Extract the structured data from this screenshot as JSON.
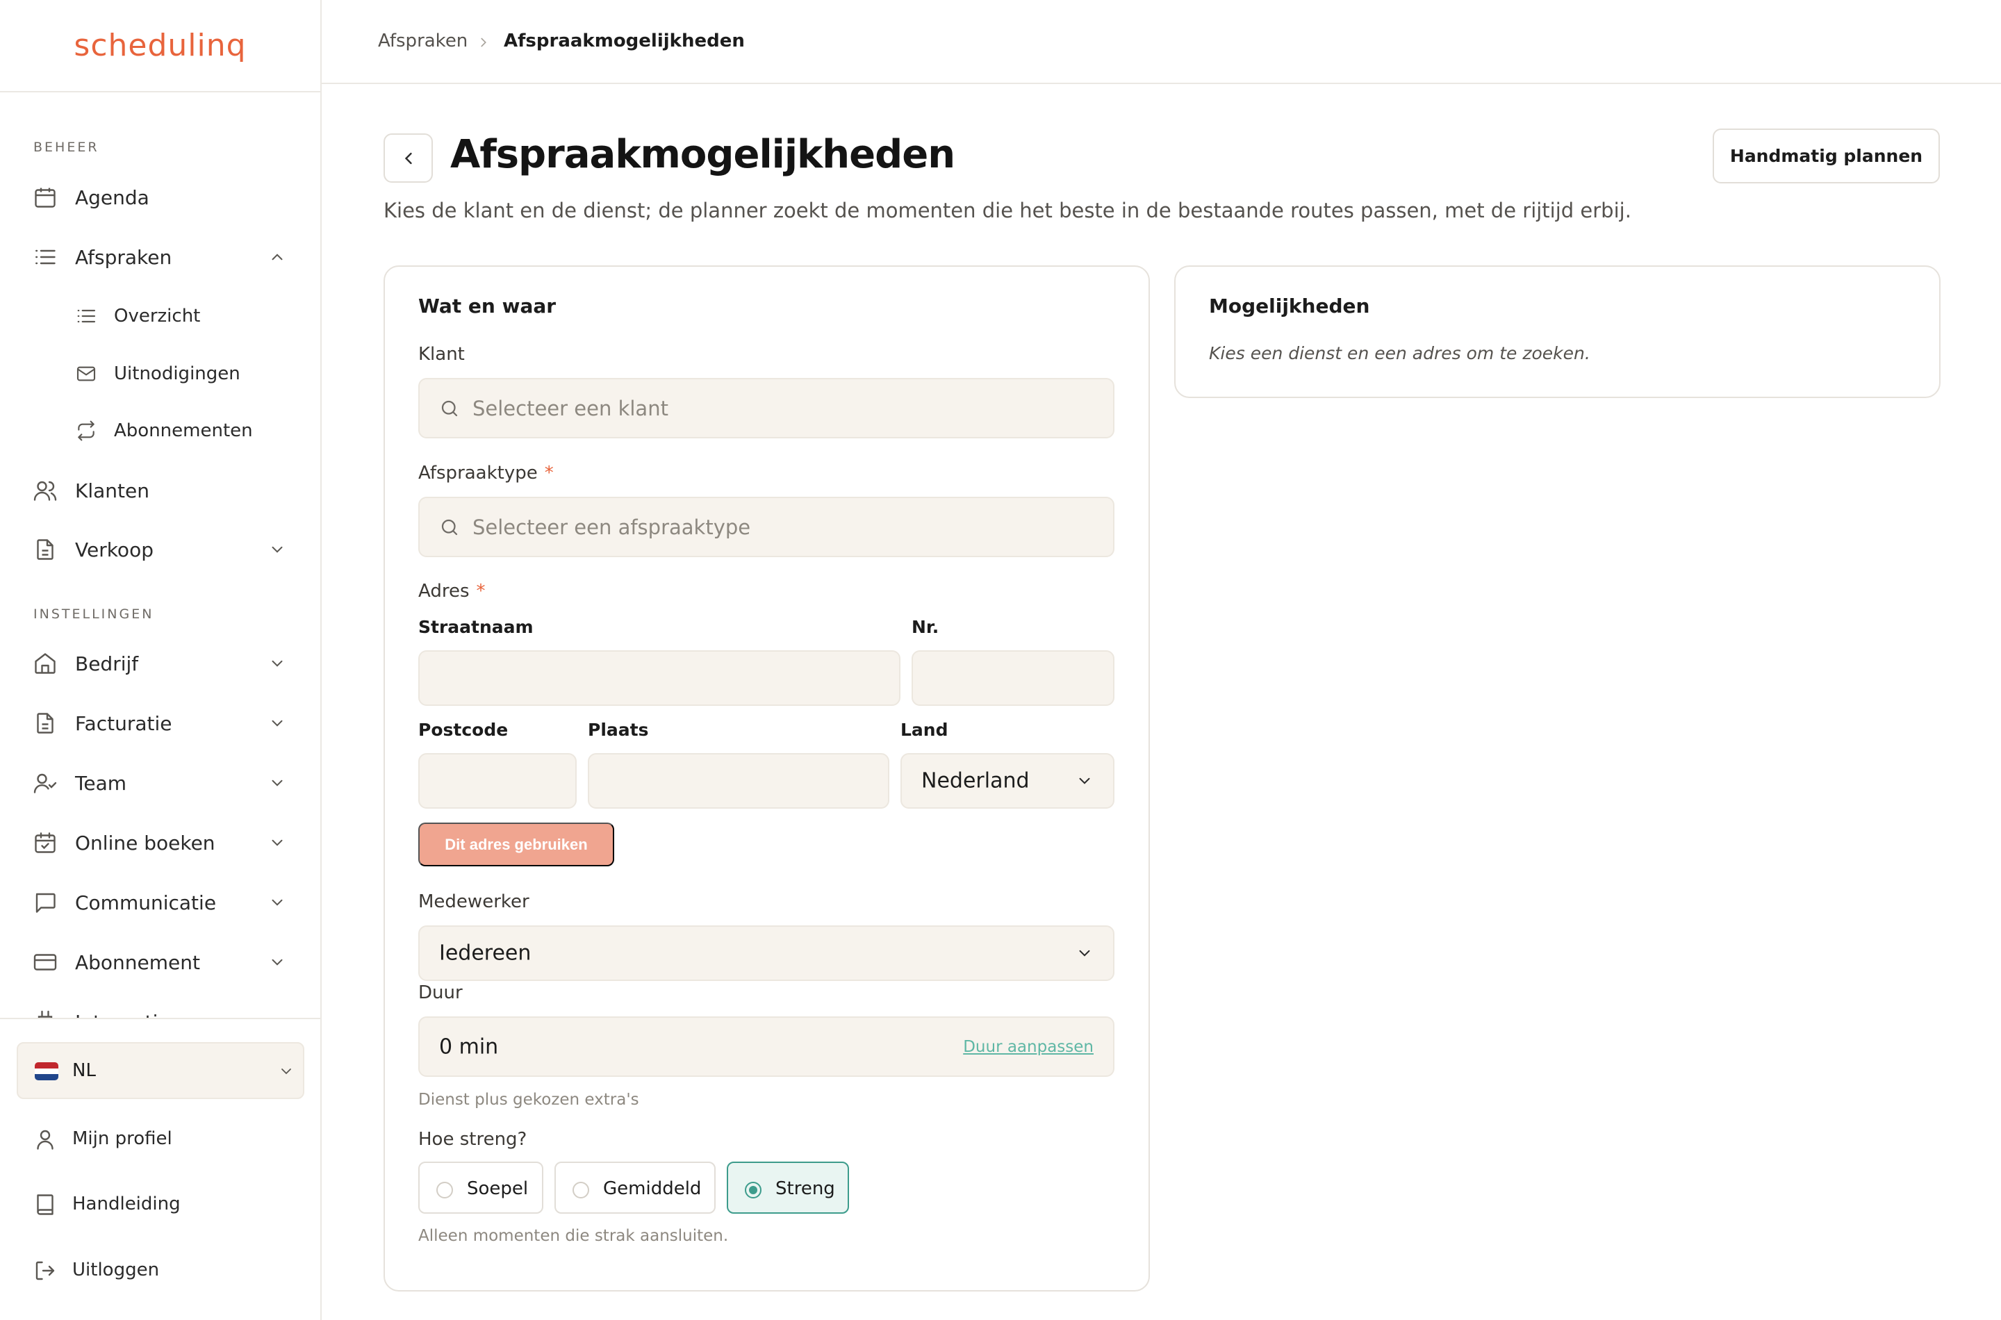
{
  "app": {
    "logo_text": "schedulinq",
    "brand_color": "#e8643c",
    "accent_color": "#3d9c8c"
  },
  "sidebar": {
    "section_beheer": "BEHEER",
    "section_instellingen": "INSTELLINGEN",
    "items": [
      {
        "label": "Agenda",
        "icon": "calendar-icon"
      },
      {
        "label": "Afspraken",
        "icon": "list-icon",
        "expanded": true
      },
      {
        "label": "Overzicht",
        "icon": "list-icon"
      },
      {
        "label": "Uitnodigingen",
        "icon": "mail-icon"
      },
      {
        "label": "Abonnementen",
        "icon": "repeat-icon"
      },
      {
        "label": "Klanten",
        "icon": "users-icon"
      },
      {
        "label": "Verkoop",
        "icon": "document-icon"
      },
      {
        "label": "Bedrijf",
        "icon": "home-icon"
      },
      {
        "label": "Facturatie",
        "icon": "document-icon"
      },
      {
        "label": "Team",
        "icon": "user-check-icon"
      },
      {
        "label": "Online boeken",
        "icon": "calendar-check-icon"
      },
      {
        "label": "Communicatie",
        "icon": "message-icon"
      },
      {
        "label": "Abonnement",
        "icon": "credit-card-icon"
      },
      {
        "label": "Integraties",
        "icon": "plug-icon"
      }
    ],
    "language": {
      "code": "NL"
    },
    "bottom": [
      {
        "label": "Mijn profiel",
        "icon": "user-icon"
      },
      {
        "label": "Handleiding",
        "icon": "book-icon"
      },
      {
        "label": "Uitloggen",
        "icon": "logout-icon"
      }
    ]
  },
  "breadcrumb": {
    "parent": "Afspraken",
    "current": "Afspraakmogelijkheden"
  },
  "page": {
    "title": "Afspraakmogelijkheden",
    "subtitle": "Kies de klant en de dienst; de planner zoekt de momenten die het beste in de bestaande routes passen, met de rijtijd erbij.",
    "manual_button": "Handmatig plannen"
  },
  "form": {
    "title": "Wat en waar",
    "client_label": "Klant",
    "client_placeholder": "Selecteer een klant",
    "type_label": "Afspraaktype",
    "required_mark": "*",
    "type_placeholder": "Selecteer een afspraaktype",
    "address_label": "Adres",
    "street_label": "Straatnaam",
    "street_value": "",
    "number_label": "Nr.",
    "number_value": "",
    "postcode_label": "Postcode",
    "postcode_value": "",
    "city_label": "Plaats",
    "city_value": "",
    "country_label": "Land",
    "country_value": "Nederland",
    "use_address_button": "Dit adres gebruiken",
    "employee_label": "Medewerker",
    "employee_value": "Iedereen",
    "duration_label": "Duur",
    "duration_value": "0 min",
    "duration_link": "Duur aanpassen",
    "duration_helper": "Dienst plus gekozen extra's",
    "strictness_label": "Hoe streng?",
    "strictness_options": [
      "Soepel",
      "Gemiddeld",
      "Streng"
    ],
    "strictness_selected": "Streng",
    "strictness_helper": "Alleen momenten die strak aansluiten."
  },
  "results": {
    "title": "Mogelijkheden",
    "empty_hint": "Kies een dienst en een adres om te zoeken."
  }
}
